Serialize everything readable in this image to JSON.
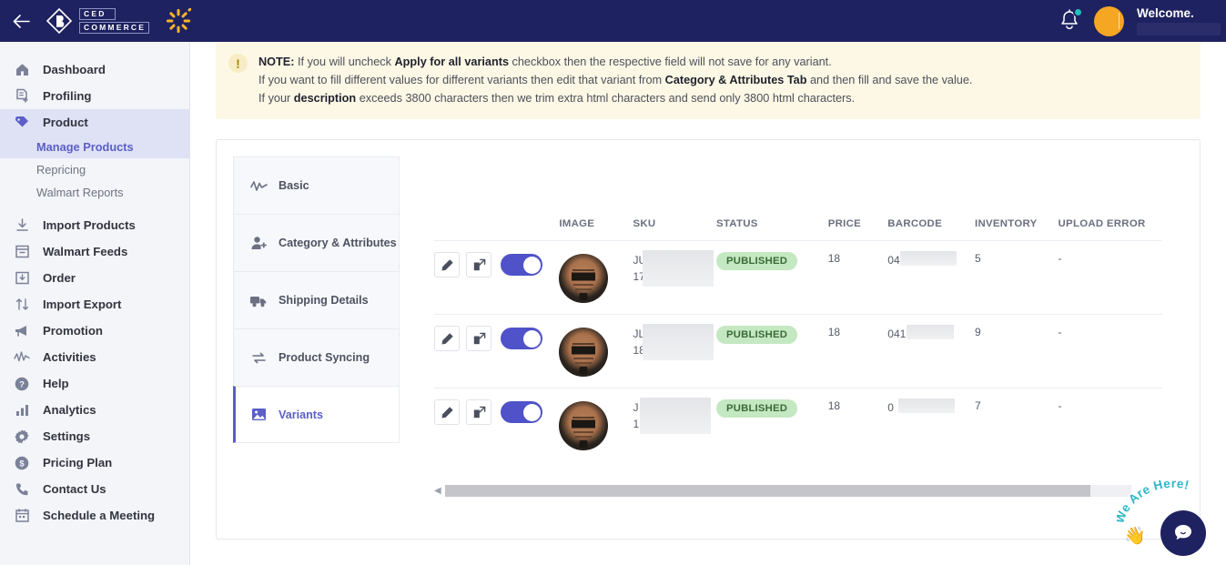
{
  "topbar": {
    "back_icon": "arrow-left-icon",
    "brand_line1": "CED",
    "brand_line2": "COMMERCE",
    "marketplace_icon": "walmart-spark-icon",
    "bell_icon": "notification-bell-icon",
    "welcome_text": "Welcome.",
    "account_name_redacted": ""
  },
  "sidebar": {
    "items": [
      {
        "label": "Dashboard",
        "icon": "home-icon",
        "active": false
      },
      {
        "label": "Profiling",
        "icon": "profile-add-icon",
        "active": false
      },
      {
        "label": "Product",
        "icon": "tag-icon",
        "active": true
      },
      {
        "label": "Import Products",
        "icon": "download-icon",
        "active": false
      },
      {
        "label": "Walmart Feeds",
        "icon": "inbox-icon",
        "active": false
      },
      {
        "label": "Order",
        "icon": "order-box-icon",
        "active": false
      },
      {
        "label": "Import Export",
        "icon": "transfer-arrows-icon",
        "active": false
      },
      {
        "label": "Promotion",
        "icon": "megaphone-icon",
        "active": false
      },
      {
        "label": "Activities",
        "icon": "activity-pulse-icon",
        "active": false
      },
      {
        "label": "Help",
        "icon": "question-circle-icon",
        "active": false
      },
      {
        "label": "Analytics",
        "icon": "bar-chart-icon",
        "active": false
      },
      {
        "label": "Settings",
        "icon": "gear-icon",
        "active": false
      },
      {
        "label": "Pricing Plan",
        "icon": "dollar-circle-icon",
        "active": false
      },
      {
        "label": "Contact Us",
        "icon": "phone-icon",
        "active": false
      },
      {
        "label": "Schedule a Meeting",
        "icon": "calendar-icon",
        "active": false
      }
    ],
    "subitems": [
      {
        "label": "Manage Products",
        "active": true
      },
      {
        "label": "Repricing",
        "active": false
      },
      {
        "label": "Walmart Reports",
        "active": false
      }
    ]
  },
  "notice": {
    "icon": "exclamation-icon",
    "line1": {
      "prefix": "NOTE:",
      "a": " If you will uncheck ",
      "bold": "Apply for all variants",
      "b": " checkbox then the respective field will not save for any variant."
    },
    "line2": {
      "a": "If you want to fill different values for different variants then edit that variant from ",
      "bold": "Category & Attributes Tab",
      "b": " and then fill and save the value."
    },
    "line3": {
      "a": "If your ",
      "bold": "description",
      "b": " exceeds 3800 characters then we trim extra html characters and send only 3800 html characters."
    }
  },
  "tabs": [
    {
      "label": "Basic",
      "icon": "pulse-icon",
      "active": false
    },
    {
      "label": "Category & Attributes",
      "icon": "user-add-icon",
      "active": false
    },
    {
      "label": "Shipping Details",
      "icon": "truck-icon",
      "active": false
    },
    {
      "label": "Product Syncing",
      "icon": "sync-arrows-icon",
      "active": false
    },
    {
      "label": "Variants",
      "icon": "image-icon",
      "active": true
    }
  ],
  "table": {
    "columns": [
      "",
      "IMAGE",
      "SKU",
      "STATUS",
      "PRICE",
      "BARCODE",
      "INVENTORY",
      "UPLOAD ERROR"
    ],
    "rows": [
      {
        "edit_icon": "pencil-icon",
        "open_icon": "open-external-icon",
        "toggle_on": true,
        "image_icon": "product-thumbnail",
        "sku_line1": "JU",
        "sku_line2": "17",
        "status": "PUBLISHED",
        "price": "18",
        "barcode": "04",
        "barcode_redact_width": 62,
        "inventory": "5",
        "upload_error": "-"
      },
      {
        "edit_icon": "pencil-icon",
        "open_icon": "open-external-icon",
        "toggle_on": true,
        "image_icon": "product-thumbnail",
        "sku_line1": "JL",
        "sku_line2": "18",
        "status": "PUBLISHED",
        "price": "18",
        "barcode": "041",
        "barcode_redact_width": 52,
        "inventory": "9",
        "upload_error": "-"
      },
      {
        "edit_icon": "pencil-icon",
        "open_icon": "open-external-icon",
        "toggle_on": true,
        "image_icon": "product-thumbnail",
        "sku_line1": "J",
        "sku_line2": "1",
        "status": "PUBLISHED",
        "price": "18",
        "barcode": "0",
        "barcode_redact_width": 62,
        "inventory": "7",
        "upload_error": "-"
      }
    ]
  },
  "scrollbar": {
    "left_arrow_icon": "caret-left-icon"
  },
  "chat": {
    "tagline": "We Are Here!",
    "wave_icon": "waving-hand-icon",
    "button_icon": "chat-bubble-icon"
  },
  "colors": {
    "brand_navy": "#1f2260",
    "accent_purple": "#5b5fc7",
    "toggle_on": "#4f52c9",
    "badge_bg": "#c4e8c2",
    "badge_text": "#3a6b38",
    "notice_bg": "#fdf8e6",
    "avatar": "#f5a623"
  }
}
